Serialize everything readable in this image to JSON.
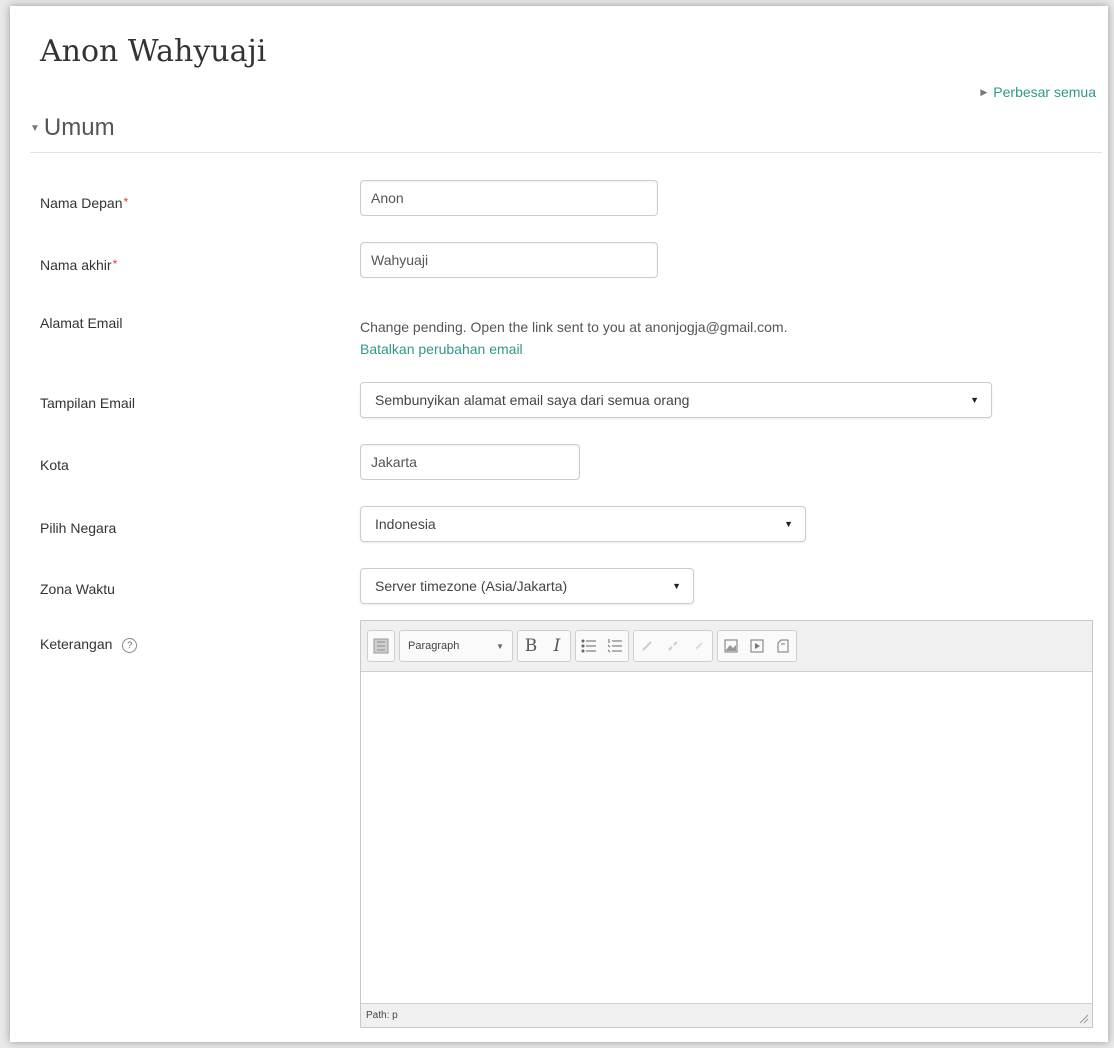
{
  "page": {
    "title": "Anon Wahyuaji",
    "expand_all": "Perbesar semua"
  },
  "section": {
    "title": "Umum"
  },
  "form": {
    "first_name": {
      "label": "Nama Depan",
      "required": "*",
      "value": "Anon"
    },
    "last_name": {
      "label": "Nama akhir",
      "required": "*",
      "value": "Wahyuaji"
    },
    "email": {
      "label": "Alamat Email",
      "message": "Change pending. Open the link sent to you at anonjogja@gmail.com.",
      "cancel_link": "Batalkan perubahan email"
    },
    "email_display": {
      "label": "Tampilan Email",
      "value": "Sembunyikan alamat email saya dari semua orang"
    },
    "city": {
      "label": "Kota",
      "value": "Jakarta"
    },
    "country": {
      "label": "Pilih Negara",
      "value": "Indonesia"
    },
    "timezone": {
      "label": "Zona Waktu",
      "value": "Server timezone (Asia/Jakarta)"
    },
    "description": {
      "label": "Keterangan",
      "help_icon": "?",
      "format_select": "Paragraph",
      "path_status": "Path: p"
    }
  },
  "icons": {
    "expand": "triangle-right",
    "collapse": "triangle-down",
    "select": "dropdown-arrow",
    "help": "question-circle"
  },
  "colors": {
    "link": "#31968c",
    "required": "#d43f3a"
  }
}
